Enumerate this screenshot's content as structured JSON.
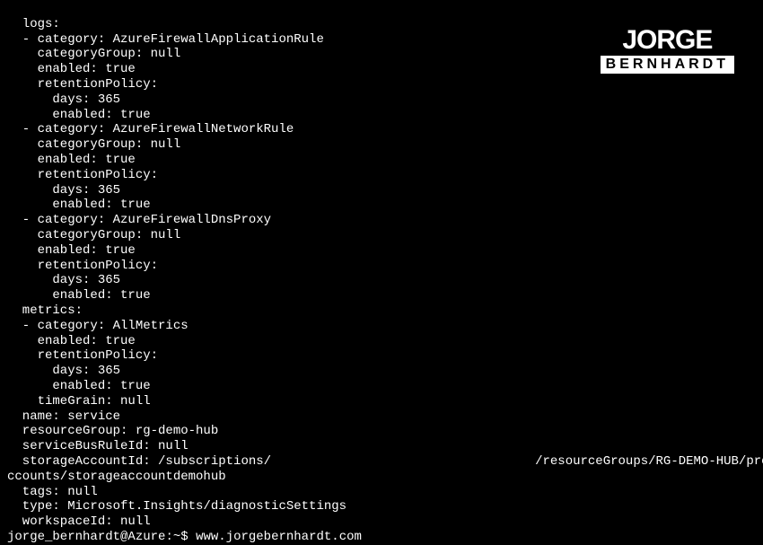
{
  "logo": {
    "top": "JORGE",
    "bottom": "BERNHARDT"
  },
  "output": {
    "lines": [
      "  logs:",
      "  - category: AzureFirewallApplicationRule",
      "    categoryGroup: null",
      "    enabled: true",
      "    retentionPolicy:",
      "      days: 365",
      "      enabled: true",
      "  - category: AzureFirewallNetworkRule",
      "    categoryGroup: null",
      "    enabled: true",
      "    retentionPolicy:",
      "      days: 365",
      "      enabled: true",
      "  - category: AzureFirewallDnsProxy",
      "    categoryGroup: null",
      "    enabled: true",
      "    retentionPolicy:",
      "      days: 365",
      "      enabled: true",
      "  metrics:",
      "  - category: AllMetrics",
      "    enabled: true",
      "    retentionPolicy:",
      "      days: 365",
      "      enabled: true",
      "    timeGrain: null",
      "  name: service",
      "  resourceGroup: rg-demo-hub",
      "  serviceBusRuleId: null",
      "  storageAccountId: /subscriptions/                                   /resourceGroups/RG-DEMO-HUB/provid",
      "ccounts/storageaccountdemohub",
      "  tags: null",
      "  type: Microsoft.Insights/diagnosticSettings",
      "  workspaceId: null"
    ]
  },
  "prompt": {
    "user_host": "jorge_bernhardt@Azure",
    "colon": ":",
    "path": "~",
    "dollar": "$ ",
    "command": "www.jorgebernhardt.com"
  }
}
